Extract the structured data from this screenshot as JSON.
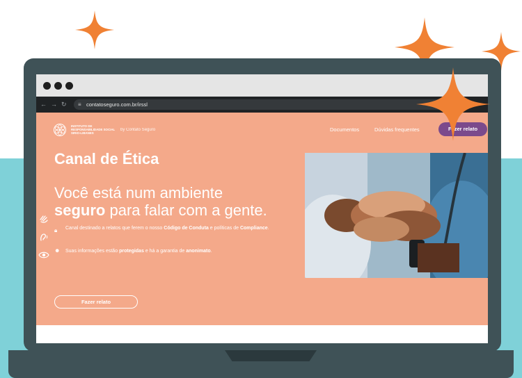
{
  "browser": {
    "window_controls": [
      "close",
      "minimize",
      "maximize"
    ],
    "nav_back_icon": "arrow-left-icon",
    "nav_forward_icon": "arrow-right-icon",
    "nav_reload_icon": "reload-icon",
    "url_icon": "site-settings-icon",
    "url": "contatoseguro.com.br/irssl"
  },
  "site": {
    "logo": {
      "line1": "INSTITUTO DE",
      "line2": "RESPONSABILIDADE SOCIAL",
      "line3": "SIRIO-LIBANES"
    },
    "by_text": "by Contato Seguro",
    "nav": {
      "documentos": "Documentos",
      "duvidas": "Dúvidas frequentes",
      "cta": "Fazer relato"
    }
  },
  "hero": {
    "title": "Canal de Ética",
    "subtitle_prefix": "Você está num ambiente",
    "subtitle_bold": "seguro",
    "subtitle_suffix": "para falar com a gente.",
    "bullet1_prefix": "Canal destinado a relatos que ferem o nosso",
    "bullet1_bold1": "Código de Conduta",
    "bullet1_middle": "e políticas de",
    "bullet1_bold2": "Compliance",
    "bullet1_suffix": ".",
    "bullet2_prefix": "Suas informações estão",
    "bullet2_bold1": "protegidas",
    "bullet2_middle": "e há a garantia de",
    "bullet2_bold2": "anonimato",
    "bullet2_suffix": ".",
    "cta": "Fazer relato"
  },
  "colors": {
    "hero_bg": "#f4a98a",
    "sparkle": "#f08134",
    "teal": "#7fd1d8",
    "laptop": "#3f5257",
    "cta_purple": "#7b4a8c"
  }
}
